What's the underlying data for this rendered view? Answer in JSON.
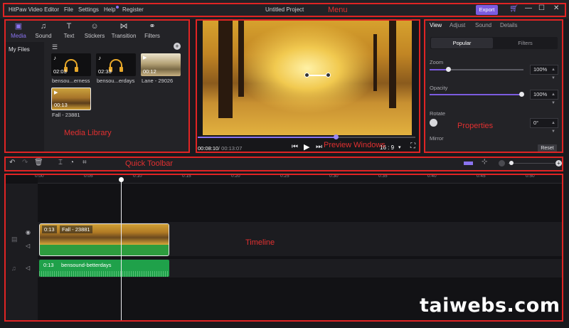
{
  "menu": {
    "app_title": "HitPaw Video Editor",
    "items": [
      "File",
      "Settings",
      "Help",
      "Register"
    ],
    "project_title": "Untitled Project",
    "export_label": "Export",
    "annotation": "Menu"
  },
  "library": {
    "tabs": [
      {
        "label": "Media",
        "icon": "film-icon"
      },
      {
        "label": "Sound",
        "icon": "music-note-icon"
      },
      {
        "label": "Text",
        "icon": "text-icon"
      },
      {
        "label": "Stickers",
        "icon": "smiley-icon"
      },
      {
        "label": "Transition",
        "icon": "bowtie-icon"
      },
      {
        "label": "Filters",
        "icon": "filters-icon"
      }
    ],
    "side_item": "My Files",
    "items": [
      {
        "duration": "02:03",
        "caption": "bensou...erness"
      },
      {
        "duration": "02:33",
        "caption": "bensou...erdays"
      },
      {
        "duration": "00:12",
        "caption": "Lane - 29026"
      },
      {
        "duration": "00:13",
        "caption": "Fall - 23881"
      }
    ],
    "annotation": "Media Library"
  },
  "preview": {
    "current_time": "00:08:10",
    "total_time": "/ 00:13:07",
    "aspect": "16 : 9",
    "progress": 0.63,
    "annotation": "Preview Windows"
  },
  "properties": {
    "tabs": [
      "View",
      "Adjust",
      "Sound",
      "Details"
    ],
    "segments": [
      "Popular",
      "Filters"
    ],
    "zoom_label": "Zoom",
    "zoom_value": "100%",
    "opacity_label": "Opacity",
    "opacity_value": "100%",
    "rotate_label": "Rotate",
    "rotate_value": "0°",
    "mirror_label": "Mirror",
    "reset_label": "Reset",
    "annotation": "Properties"
  },
  "toolbar": {
    "annotation": "Quick Toolbar"
  },
  "timeline": {
    "ticks": [
      "0:00",
      "0:05",
      "0:10",
      "0:15",
      "0:20",
      "0:25",
      "0:30",
      "0:35",
      "0:40",
      "0:45",
      "0:50"
    ],
    "video_clip": {
      "duration": "0:13",
      "name": "Fall - 23881"
    },
    "audio_clip": {
      "duration": "0:13",
      "name": "bensound-betterdays"
    },
    "annotation": "Timeline"
  },
  "watermark": "taiwebs.com",
  "colors": {
    "accent": "#7c5ce0",
    "annotation": "#e02424",
    "audio_clip": "#1fa14a"
  }
}
